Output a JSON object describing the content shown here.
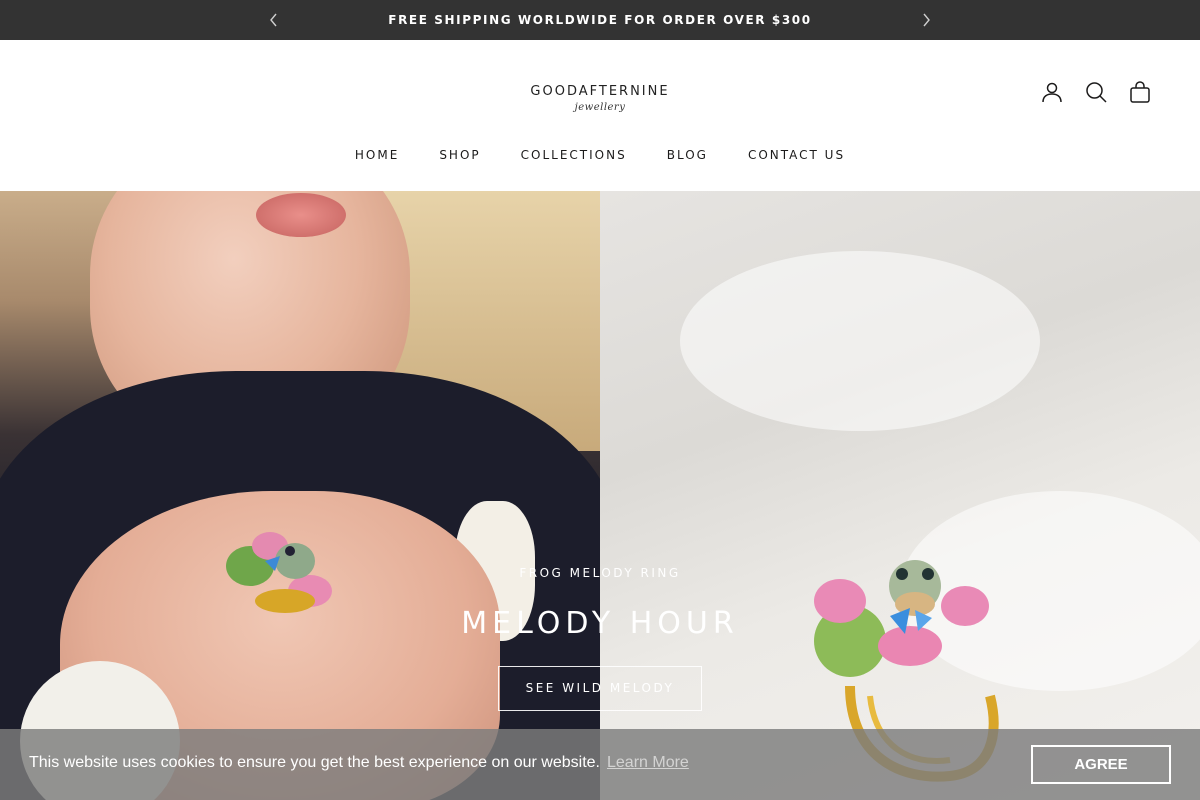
{
  "announcement": {
    "text": "FREE SHIPPING WORLDWIDE FOR ORDER OVER $300",
    "prev_icon": "chevron-left-icon",
    "next_icon": "chevron-right-icon"
  },
  "header": {
    "logo_main": "GOODAFTERNINE",
    "logo_sub": "jewellery",
    "icons": [
      "account-icon",
      "search-icon",
      "cart-icon"
    ],
    "nav": [
      "HOME",
      "SHOP",
      "COLLECTIONS",
      "BLOG",
      "CONTACT US"
    ]
  },
  "hero": {
    "subtitle": "FROG MELODY RING",
    "title": "MELODY HOUR",
    "button": "SEE WILD MELODY"
  },
  "cookie": {
    "message": "This website uses cookies to ensure you get the best experience on our website.",
    "link": "Learn More",
    "button": "AGREE"
  }
}
